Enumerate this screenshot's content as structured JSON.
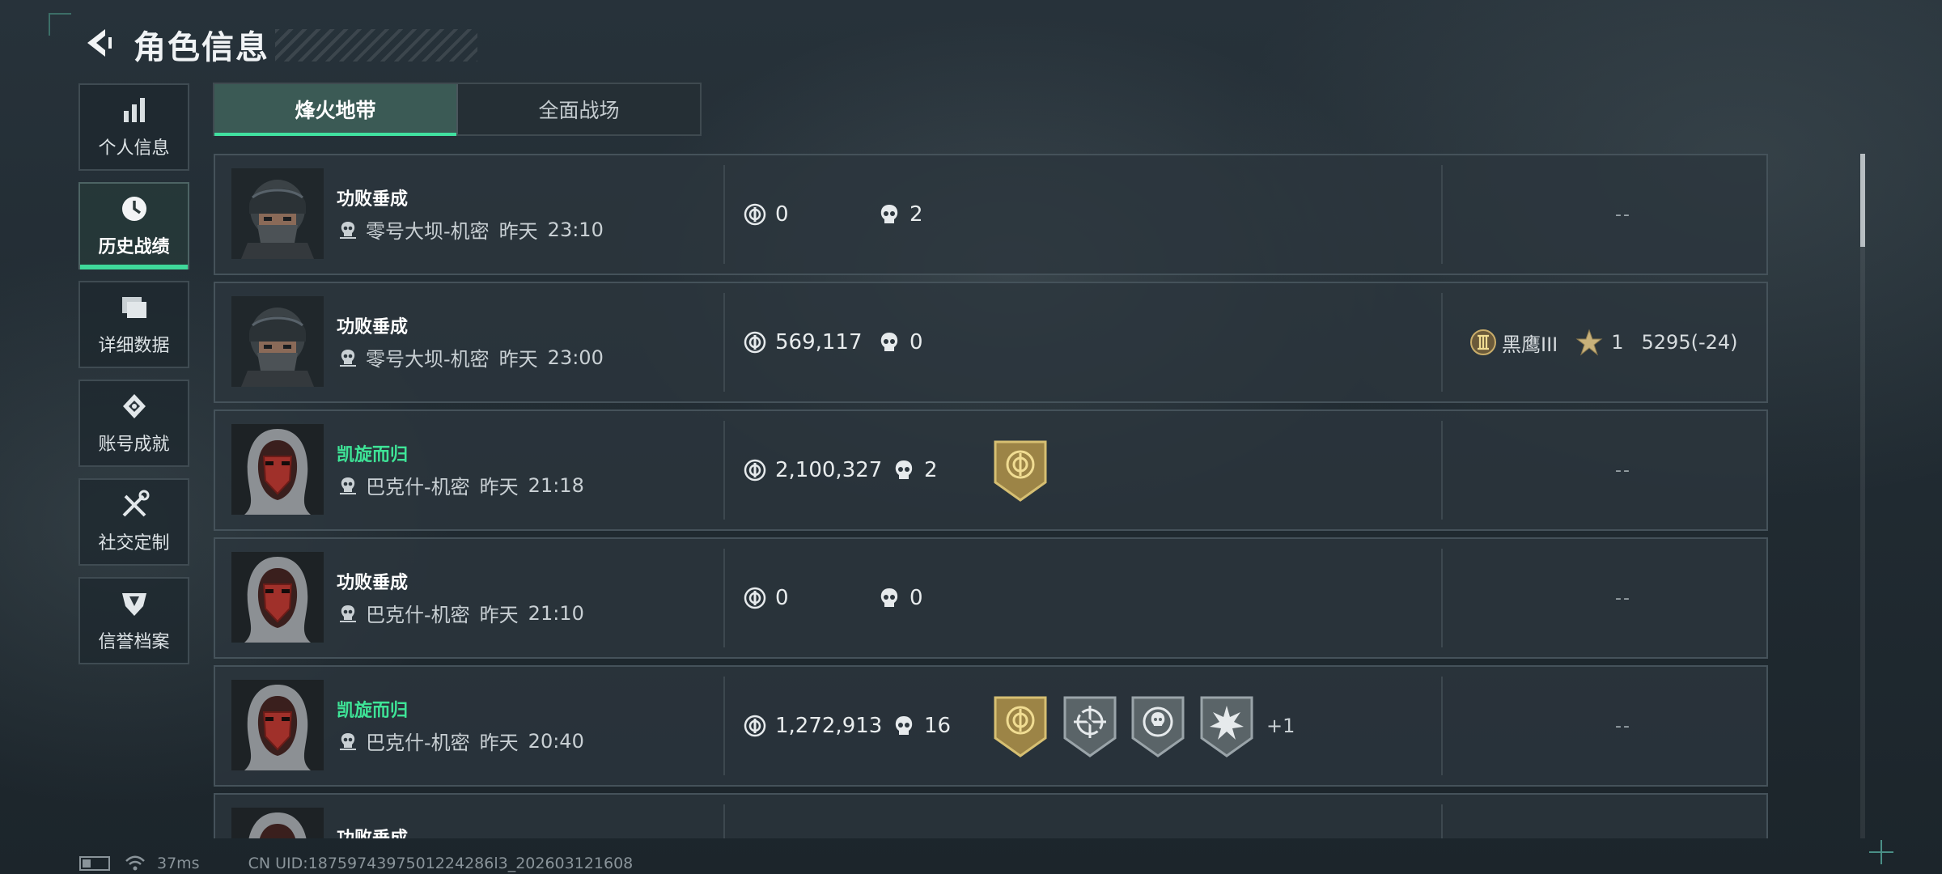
{
  "header": {
    "title": "角色信息"
  },
  "sidebar": {
    "items": [
      {
        "label": "个人信息",
        "icon": "bar-chart-icon",
        "active": false
      },
      {
        "label": "历史战绩",
        "icon": "clock-icon",
        "active": true
      },
      {
        "label": "详细数据",
        "icon": "folder-icon",
        "active": false
      },
      {
        "label": "账号成就",
        "icon": "achievement-icon",
        "active": false
      },
      {
        "label": "社交定制",
        "icon": "tools-icon",
        "active": false
      },
      {
        "label": "信誉档案",
        "icon": "shield-icon",
        "active": false
      }
    ]
  },
  "tabs": [
    {
      "label": "烽火地带",
      "active": true
    },
    {
      "label": "全面战场",
      "active": false
    }
  ],
  "matches": [
    {
      "result": "功败垂成",
      "outcome": "fail",
      "map": "零号大坝-机密",
      "day": "昨天",
      "time": "23:10",
      "value": "0",
      "kills": "2",
      "badges": [],
      "extra": "",
      "summary": "--",
      "operator": "helmet"
    },
    {
      "result": "功败垂成",
      "outcome": "fail",
      "map": "零号大坝-机密",
      "day": "昨天",
      "time": "23:00",
      "value": "569,117",
      "kills": "0",
      "badges": [],
      "extra": "",
      "summary": "",
      "rank": {
        "tier": "黑鹰III",
        "stars": "1",
        "points": "5295(-24)"
      },
      "operator": "helmet"
    },
    {
      "result": "凯旋而归",
      "outcome": "win",
      "map": "巴克什-机密",
      "day": "昨天",
      "time": "21:18",
      "value": "2,100,327",
      "kills": "2",
      "badges": [
        "gold-medal-icon"
      ],
      "extra": "",
      "summary": "--",
      "operator": "hood"
    },
    {
      "result": "功败垂成",
      "outcome": "fail",
      "map": "巴克什-机密",
      "day": "昨天",
      "time": "21:10",
      "value": "0",
      "kills": "0",
      "badges": [],
      "extra": "",
      "summary": "--",
      "operator": "hood"
    },
    {
      "result": "凯旋而归",
      "outcome": "win",
      "map": "巴克什-机密",
      "day": "昨天",
      "time": "20:40",
      "value": "1,272,913",
      "kills": "16",
      "badges": [
        "gold-medal-icon",
        "crosshair-medal-icon",
        "skull-target-medal-icon",
        "burst-medal-icon"
      ],
      "extra": "+1",
      "summary": "--",
      "operator": "hood"
    },
    {
      "result": "功败垂成",
      "outcome": "fail",
      "map": "",
      "day": "",
      "time": "",
      "value": "",
      "kills": "",
      "badges": [],
      "extra": "",
      "summary": "",
      "operator": "hood"
    }
  ],
  "footer": {
    "ping": "37ms",
    "uid": "CN UID:1875974397501224286l3_202603121608"
  },
  "colors": {
    "accent": "#41e0a0",
    "win": "#3ee497",
    "panel": "#2c363d"
  }
}
